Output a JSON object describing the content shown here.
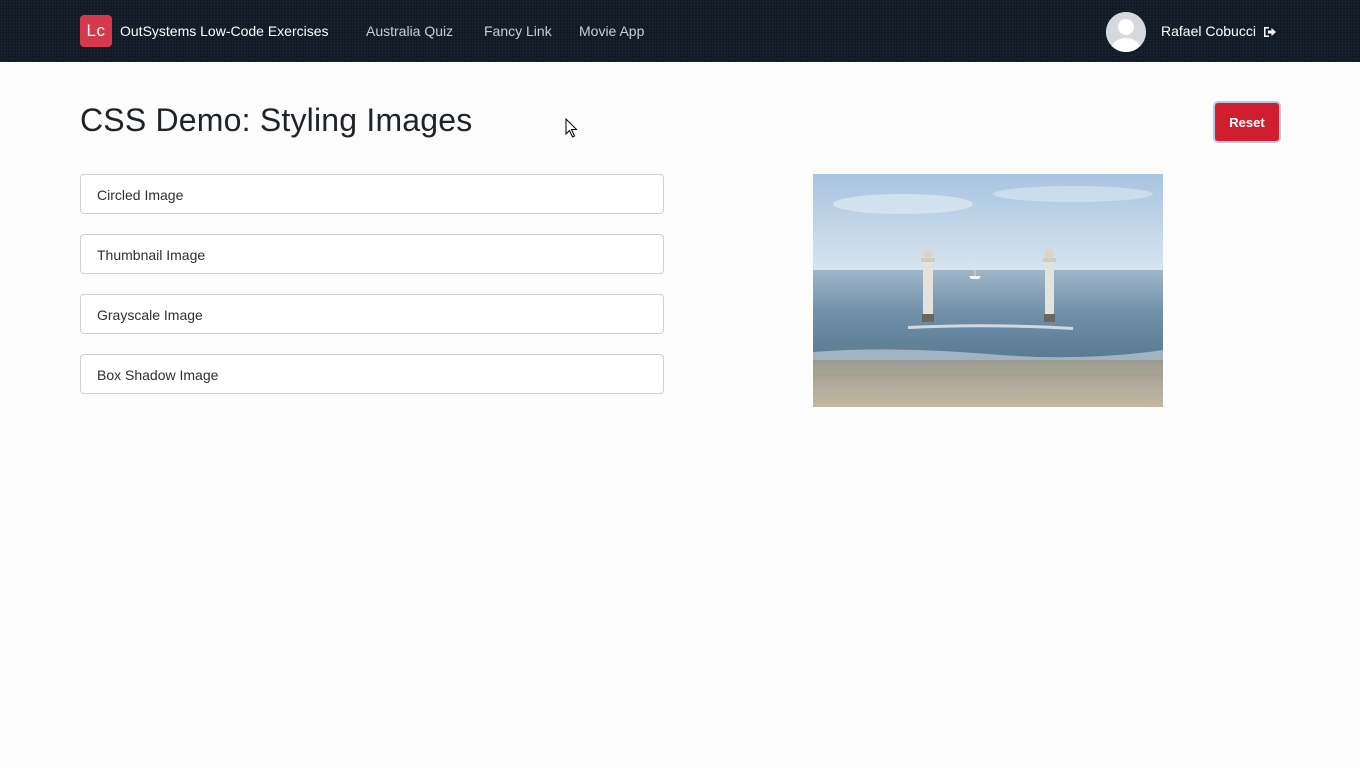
{
  "header": {
    "logo_text": "Lc",
    "app_title": "OutSystems Low-Code Exercises",
    "nav": [
      {
        "label": "Australia Quiz"
      },
      {
        "label": "Fancy Link"
      },
      {
        "label": "Movie App"
      }
    ],
    "user_name": "Rafael Cobucci",
    "icons": {
      "avatar": "user-avatar-icon",
      "logout": "sign-out-icon"
    }
  },
  "main": {
    "title": "CSS Demo: Styling Images",
    "reset_label": "Reset",
    "options": [
      {
        "label": "Circled Image"
      },
      {
        "label": "Thumbnail Image"
      },
      {
        "label": "Grayscale Image"
      },
      {
        "label": "Box Shadow Image"
      }
    ],
    "image_subject": "seaside pillars photo"
  },
  "colors": {
    "header_bg": "#111a24",
    "logo_bg": "#d43a4c",
    "reset_bg": "#cf1f2e",
    "page_bg": "#fcfcfd"
  }
}
